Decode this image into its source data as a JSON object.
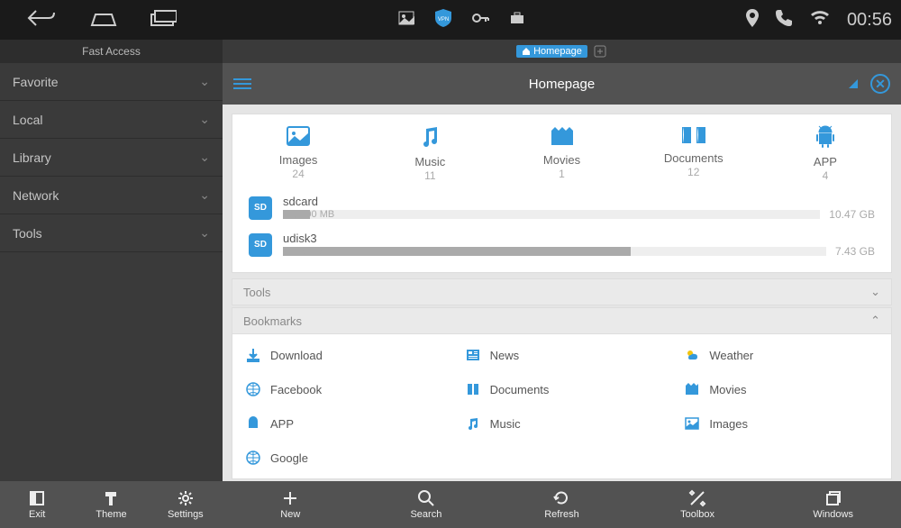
{
  "status": {
    "clock": "00:56"
  },
  "sidebar": {
    "title": "Fast Access",
    "items": [
      {
        "label": "Favorite"
      },
      {
        "label": "Local"
      },
      {
        "label": "Library"
      },
      {
        "label": "Network"
      },
      {
        "label": "Tools"
      }
    ]
  },
  "tab": {
    "label": "Homepage"
  },
  "appbar": {
    "title": "Homepage"
  },
  "categories": [
    {
      "label": "Images",
      "count": "24"
    },
    {
      "label": "Music",
      "count": "11"
    },
    {
      "label": "Movies",
      "count": "1"
    },
    {
      "label": "Documents",
      "count": "12"
    },
    {
      "label": "APP",
      "count": "4"
    }
  ],
  "storage": [
    {
      "name": "sdcard",
      "used": "557.00 MB",
      "total": "10.47 GB",
      "pct": 5
    },
    {
      "name": "udisk3",
      "used": "4.75 GB",
      "total": "7.43 GB",
      "pct": 64
    }
  ],
  "sections": {
    "tools": "Tools",
    "bookmarks": "Bookmarks"
  },
  "bookmarks": {
    "row1": [
      {
        "label": "Download"
      },
      {
        "label": "News"
      },
      {
        "label": "Weather"
      }
    ],
    "row2": [
      {
        "label": "Facebook"
      },
      {
        "label": "Documents"
      },
      {
        "label": "Movies"
      }
    ],
    "row3": [
      {
        "label": "APP"
      },
      {
        "label": "Music"
      },
      {
        "label": "Images"
      }
    ],
    "row4": [
      {
        "label": "Google"
      }
    ]
  },
  "bottom": {
    "side": [
      {
        "label": "Exit"
      },
      {
        "label": "Theme"
      },
      {
        "label": "Settings"
      }
    ],
    "main": [
      {
        "label": "New"
      },
      {
        "label": "Search"
      },
      {
        "label": "Refresh"
      },
      {
        "label": "Toolbox"
      },
      {
        "label": "Windows"
      }
    ]
  }
}
